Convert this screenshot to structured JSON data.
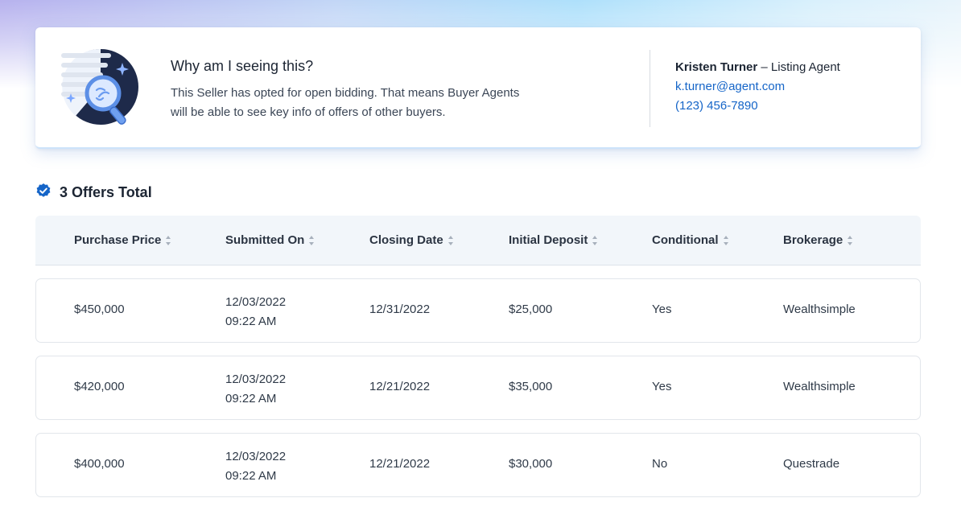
{
  "info": {
    "title": "Why am I seeing this?",
    "desc_line1": "This Seller has opted for open bidding. That means Buyer Agents",
    "desc_line2": "will be able to see key info of offers of other buyers.",
    "agent_name": "Kristen Turner",
    "agent_role": " – Listing Agent",
    "agent_email": "k.turner@agent.com",
    "agent_phone": "(123) 456-7890"
  },
  "offers": {
    "title": "3 Offers Total",
    "columns": [
      "Purchase Price",
      "Submitted On",
      "Closing Date",
      "Initial Deposit",
      "Conditional",
      "Brokerage"
    ],
    "rows": [
      {
        "price": "$450,000",
        "date": "12/03/2022",
        "time": "09:22 AM",
        "closing": "12/31/2022",
        "deposit": "$25,000",
        "conditional": "Yes",
        "brokerage": "Wealthsimple"
      },
      {
        "price": "$420,000",
        "date": "12/03/2022",
        "time": "09:22 AM",
        "closing": "12/21/2022",
        "deposit": "$35,000",
        "conditional": "Yes",
        "brokerage": "Wealthsimple"
      },
      {
        "price": "$400,000",
        "date": "12/03/2022",
        "time": "09:22 AM",
        "closing": "12/21/2022",
        "deposit": "$30,000",
        "conditional": "No",
        "brokerage": "Questrade"
      }
    ]
  },
  "icons": {
    "illustration": "magnifier-document-illustration",
    "verified": "verified-check-icon",
    "sort": "sort-icon"
  },
  "colors": {
    "accent": "#1565c8",
    "text": "#1c2533",
    "header_bg": "#f2f6fa"
  }
}
